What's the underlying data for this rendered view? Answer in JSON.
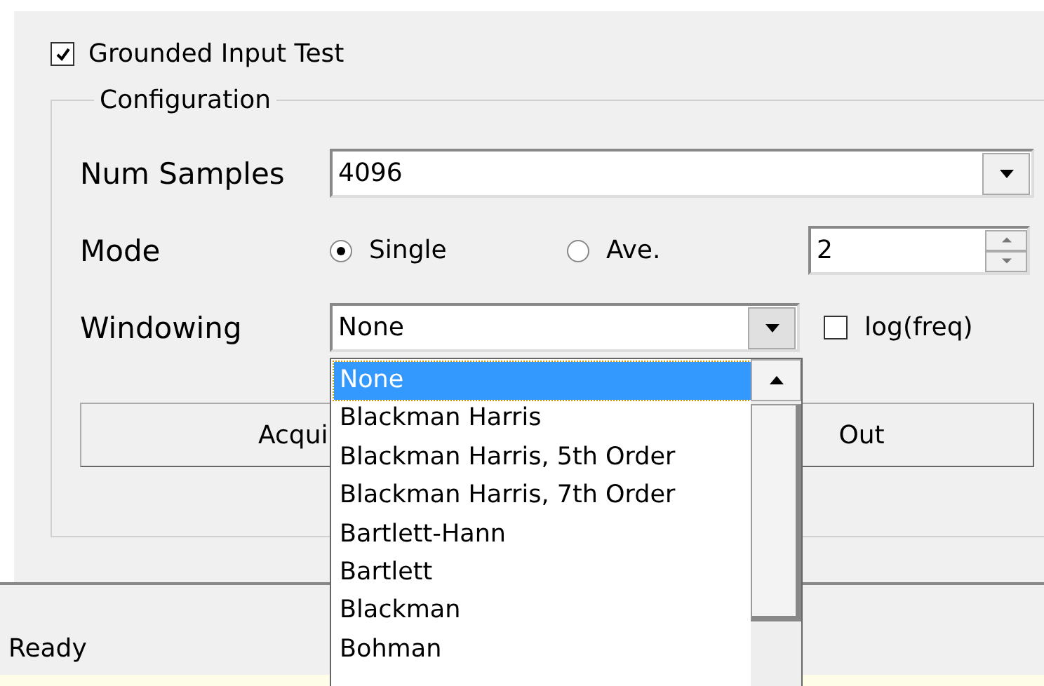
{
  "grounded_input_test": {
    "label": "Grounded Input Test",
    "checked": true
  },
  "configuration": {
    "title": "Configuration",
    "num_samples": {
      "label": "Num Samples",
      "value": "4096"
    },
    "mode": {
      "label": "Mode",
      "options": [
        {
          "label": "Single",
          "selected": true
        },
        {
          "label": "Ave.",
          "selected": false
        }
      ],
      "averages": "2"
    },
    "windowing": {
      "label": "Windowing",
      "value": "None",
      "expanded": true,
      "options": [
        {
          "label": "None",
          "selected": true
        },
        {
          "label": "Blackman Harris",
          "selected": false
        },
        {
          "label": "Blackman Harris, 5th Order",
          "selected": false
        },
        {
          "label": "Blackman Harris, 7th Order",
          "selected": false
        },
        {
          "label": "Bartlett-Hann",
          "selected": false
        },
        {
          "label": "Bartlett",
          "selected": false
        },
        {
          "label": "Blackman",
          "selected": false
        },
        {
          "label": "Bohman",
          "selected": false
        }
      ]
    },
    "log_freq": {
      "label": "log(freq)",
      "checked": false
    },
    "acquire_button": {
      "visible_text": [
        "Acqui",
        "Out"
      ]
    }
  },
  "status_bar": {
    "text": "Ready"
  }
}
